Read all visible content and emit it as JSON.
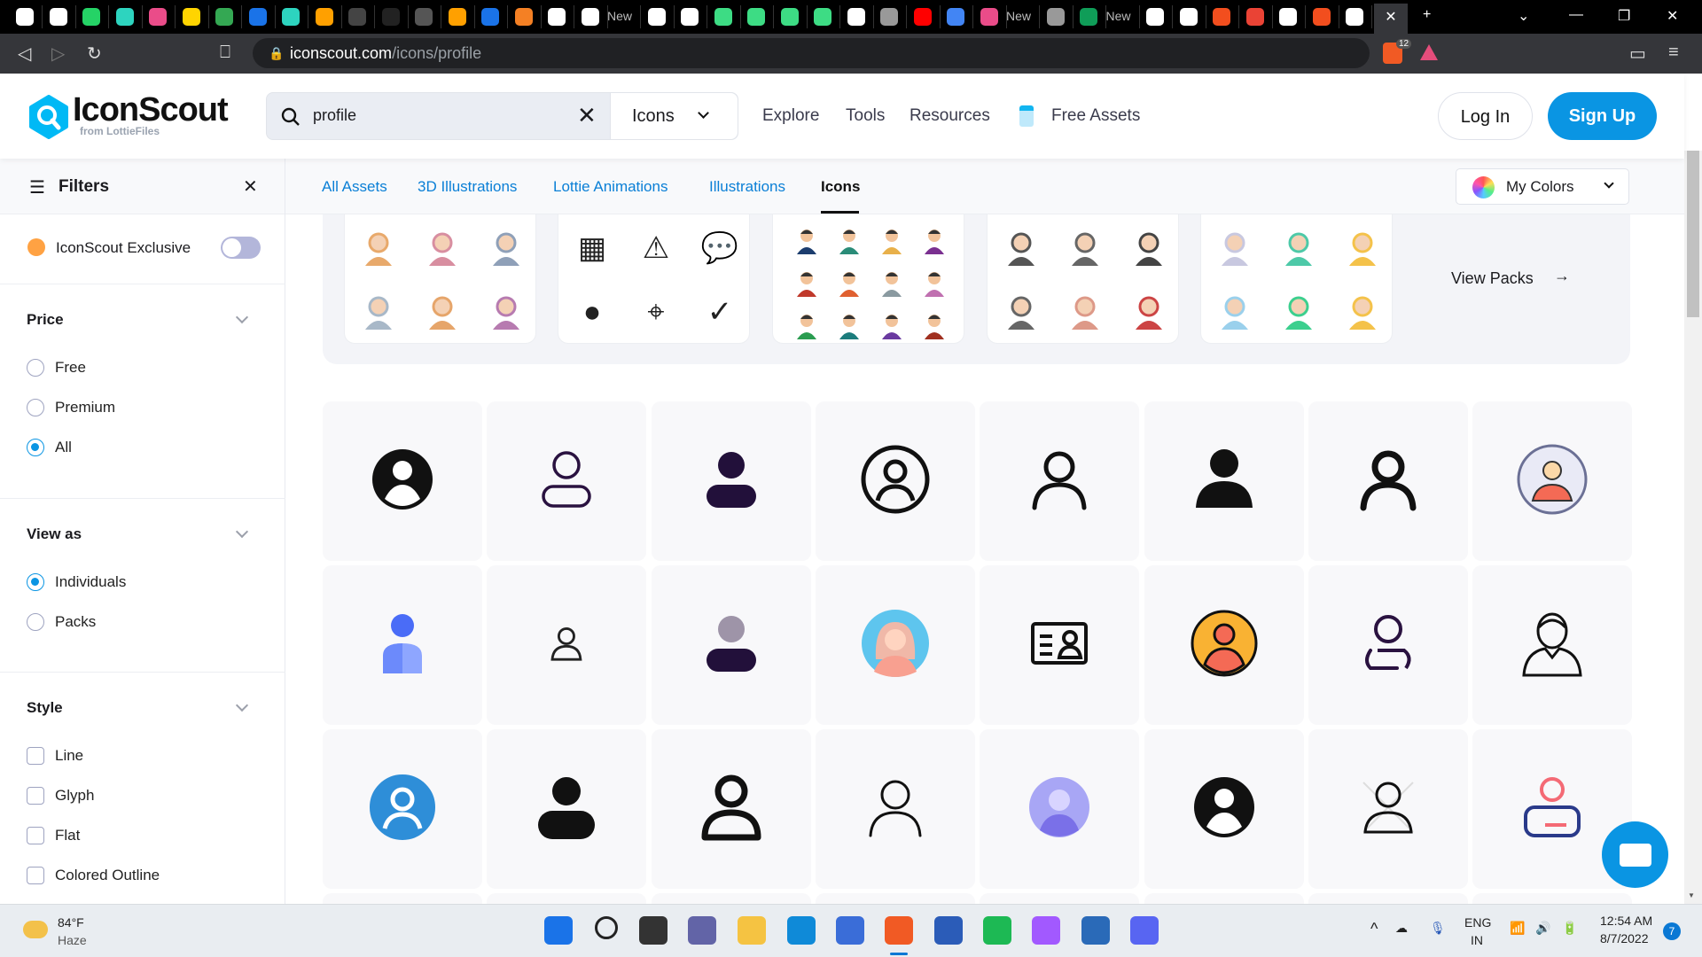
{
  "browser": {
    "url_host": "iconscout.com",
    "url_path": "/icons/profile",
    "tab_labels": [
      "New",
      "New",
      "New"
    ],
    "shield_badge": "12"
  },
  "header": {
    "logo": "IconScout",
    "logo_sub": "from LottieFiles",
    "search_value": "profile",
    "search_type": "Icons",
    "nav": [
      "Explore",
      "Tools",
      "Resources",
      "Free Assets"
    ],
    "login": "Log In",
    "signup": "Sign Up",
    "accent": "#0a95e3"
  },
  "sidebar": {
    "title": "Filters",
    "exclusive": "IconScout Exclusive",
    "exclusive_on": false,
    "price": {
      "title": "Price",
      "options": [
        "Free",
        "Premium",
        "All"
      ],
      "selected": "All"
    },
    "view_as": {
      "title": "View as",
      "options": [
        "Individuals",
        "Packs"
      ],
      "selected": "Individuals"
    },
    "style": {
      "title": "Style",
      "options": [
        "Line",
        "Glyph",
        "Flat",
        "Colored Outline"
      ]
    }
  },
  "content": {
    "tabs": [
      "All Assets",
      "3D Illustrations",
      "Lottie Animations",
      "Illustrations",
      "Icons"
    ],
    "active_tab": "Icons",
    "my_colors": "My Colors",
    "view_packs": "View Packs"
  },
  "grid_icons": [
    "user-circle-solid",
    "user-outline-thin",
    "user-glyph-purple",
    "user-circle-outline",
    "user-outline",
    "user-glyph",
    "user-outline-bold",
    "user-avatar-flat",
    "user-blue-flat",
    "user-outline-small",
    "user-grey-duotone",
    "user-avatar-woman",
    "id-card",
    "user-orange-circle",
    "user-outline-purple",
    "user-man-outline",
    "user-blue-circle",
    "user-glyph-rounded",
    "user-outline-heavy",
    "user-outline-light",
    "user-purple-blur",
    "user-circle-solid-2",
    "user-outline-cross",
    "user-red-outline"
  ],
  "taskbar": {
    "weather_temp": "84°F",
    "weather_desc": "Haze",
    "lang": "ENG",
    "region": "IN",
    "time": "12:54 AM",
    "date": "8/7/2022",
    "notifications": "7"
  }
}
